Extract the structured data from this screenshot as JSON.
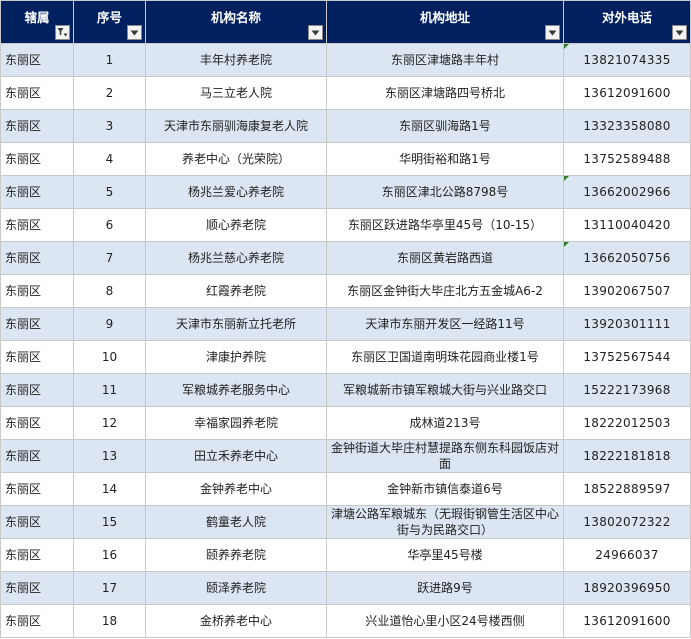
{
  "headers": {
    "district": "辖属",
    "seq": "序号",
    "name": "机构名称",
    "address": "机构地址",
    "phone": "对外电话"
  },
  "rows": [
    {
      "district": "东丽区",
      "seq": "1",
      "name": "丰年村养老院",
      "address": "东丽区津塘路丰年村",
      "phone": "13821074335"
    },
    {
      "district": "东丽区",
      "seq": "2",
      "name": "马三立老人院",
      "address": "东丽区津塘路四号桥北",
      "phone": "13612091600"
    },
    {
      "district": "东丽区",
      "seq": "3",
      "name": "天津市东丽驯海康复老人院",
      "address": "东丽区驯海路1号",
      "phone": "13323358080"
    },
    {
      "district": "东丽区",
      "seq": "4",
      "name": "养老中心（光荣院）",
      "address": "华明街裕和路1号",
      "phone": "13752589488"
    },
    {
      "district": "东丽区",
      "seq": "5",
      "name": "杨兆兰爱心养老院",
      "address": "东丽区津北公路8798号",
      "phone": "13662002966"
    },
    {
      "district": "东丽区",
      "seq": "6",
      "name": "顺心养老院",
      "address": "东丽区跃进路华亭里45号（10-15）",
      "phone": "13110040420"
    },
    {
      "district": "东丽区",
      "seq": "7",
      "name": "杨兆兰慈心养老院",
      "address": "东丽区黄岩路西道",
      "phone": "13662050756"
    },
    {
      "district": "东丽区",
      "seq": "8",
      "name": "红霞养老院",
      "address": "东丽区金钟街大毕庄北方五金城A6-2",
      "phone": "13902067507"
    },
    {
      "district": "东丽区",
      "seq": "9",
      "name": "天津市东丽新立托老所",
      "address": "天津市东丽开发区一经路11号",
      "phone": "13920301111"
    },
    {
      "district": "东丽区",
      "seq": "10",
      "name": "津康护养院",
      "address": "东丽区卫国道南明珠花园商业楼1号",
      "phone": "13752567544"
    },
    {
      "district": "东丽区",
      "seq": "11",
      "name": "军粮城养老服务中心",
      "address": "军粮城新市镇军粮城大街与兴业路交口",
      "phone": "15222173968"
    },
    {
      "district": "东丽区",
      "seq": "12",
      "name": "幸福家园养老院",
      "address": "成林道213号",
      "phone": "18222012503"
    },
    {
      "district": "东丽区",
      "seq": "13",
      "name": "田立禾养老中心",
      "address": "金钟街道大毕庄村慧提路东侧东科园饭店对面",
      "phone": "18222181818"
    },
    {
      "district": "东丽区",
      "seq": "14",
      "name": "金钟养老中心",
      "address": "金钟新市镇信泰道6号",
      "phone": "18522889597"
    },
    {
      "district": "东丽区",
      "seq": "15",
      "name": "鹤童老人院",
      "address": "津塘公路军粮城东（无瑕街钢管生活区中心街与为民路交口）",
      "phone": "13802072322"
    },
    {
      "district": "东丽区",
      "seq": "16",
      "name": "颐养养老院",
      "address": "华亭里45号楼",
      "phone": "24966037"
    },
    {
      "district": "东丽区",
      "seq": "17",
      "name": "颐泽养老院",
      "address": "跃进路9号",
      "phone": "18920396950"
    },
    {
      "district": "东丽区",
      "seq": "18",
      "name": "金桥养老中心",
      "address": "兴业道怡心里小区24号楼西侧",
      "phone": "13612091600"
    }
  ],
  "colors": {
    "header_bg": "#002060",
    "band_blue": "#dce6f2",
    "band_white": "#ffffff",
    "grid": "#c9c9c9",
    "note_marker": "#2d7d2d"
  },
  "icons": {
    "filter_active": "filter-funnel-icon",
    "dropdown": "dropdown-arrow-icon"
  }
}
